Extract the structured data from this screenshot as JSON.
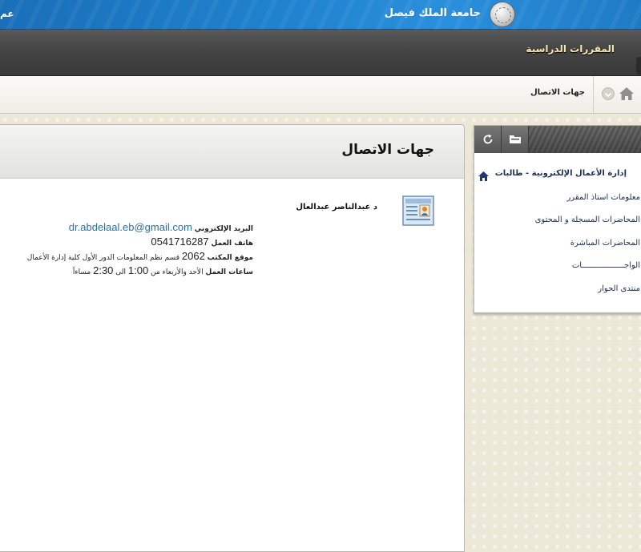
{
  "banner": {
    "university_name": "جامعة الملك فيصل",
    "left_text": "عم"
  },
  "tabs": {
    "courses": "المقررات الدراسية"
  },
  "breadcrumb": {
    "current": "جهات الاتصال"
  },
  "main": {
    "title": "جهات الاتصال",
    "contact": {
      "name": "د عبدالناصر عبدالعال",
      "email_label": "البريد الإلكتروني",
      "email": "dr.abdelaal.eb@gmail.com",
      "phone_label": "هاتف العمل",
      "phone": "0541716287",
      "office_label": "موقع المكتب",
      "office_number": "2062",
      "office_desc": "قسم نظم المعلومات الدور الأول كلية إدارة الأعمال",
      "hours_label": "ساعات العمل",
      "hours_days": "الأحد والأربعاء من",
      "hours_from": "1:00",
      "hours_to_word": "الى",
      "hours_to": "2:30",
      "hours_period": "مساءاً"
    }
  },
  "course_menu": {
    "course_title": "إدارة الأعمال الإلكترونية - طالبات",
    "links": [
      "معلومات استاذ المقرر",
      "المحاضرات المسجلة و المحتوى",
      "المحاضرات المباشرة",
      "الواجــــــــــــــــــات",
      "منتدى الحوار"
    ]
  },
  "colors": {
    "banner_blue": "#1f80cc",
    "tab_bar": "#444444",
    "link_navy": "#1c2f57",
    "email_blue": "#2a6fa8"
  }
}
